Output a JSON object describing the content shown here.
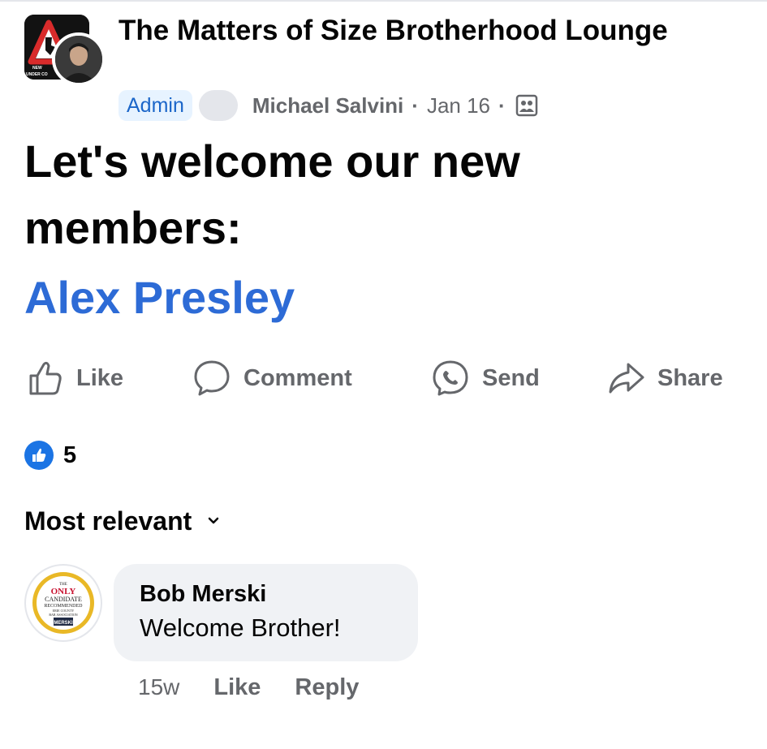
{
  "header": {
    "group_name": "The Matters of Size Brotherhood Lounge",
    "group_logo_text": [
      "NEW",
      "UNDER CO"
    ],
    "admin_badge": "Admin",
    "author": "Michael Salvini",
    "separator": "·",
    "date": "Jan 16",
    "privacy_icon": "group-members-icon"
  },
  "post": {
    "text": "Let's welcome our new members:",
    "link": "Alex Presley"
  },
  "actions": [
    {
      "label": "Like",
      "icon": "thumbs-up-icon"
    },
    {
      "label": "Comment",
      "icon": "comment-icon"
    },
    {
      "label": "Send",
      "icon": "messenger-icon"
    },
    {
      "label": "Share",
      "icon": "share-icon"
    }
  ],
  "reactions": {
    "icon": "like-reaction-icon",
    "count": "5"
  },
  "sort": {
    "label": "Most relevant"
  },
  "comment": {
    "author": "Bob Merski",
    "text": "Welcome Brother!",
    "time": "15w",
    "like_label": "Like",
    "reply_label": "Reply",
    "avatar_text": [
      "THE",
      "ONLY",
      "CANDIDATE",
      "RECOMMENDED",
      "ERIE COUNTY",
      "BAR ASSOCIATION",
      "MERSKI"
    ]
  },
  "colors": {
    "link_blue": "#2d6bd6",
    "badge_bg": "#e7f3ff",
    "muted_text": "#65676b",
    "bubble_bg": "#f0f2f5",
    "like_blue": "#1b74e4"
  }
}
